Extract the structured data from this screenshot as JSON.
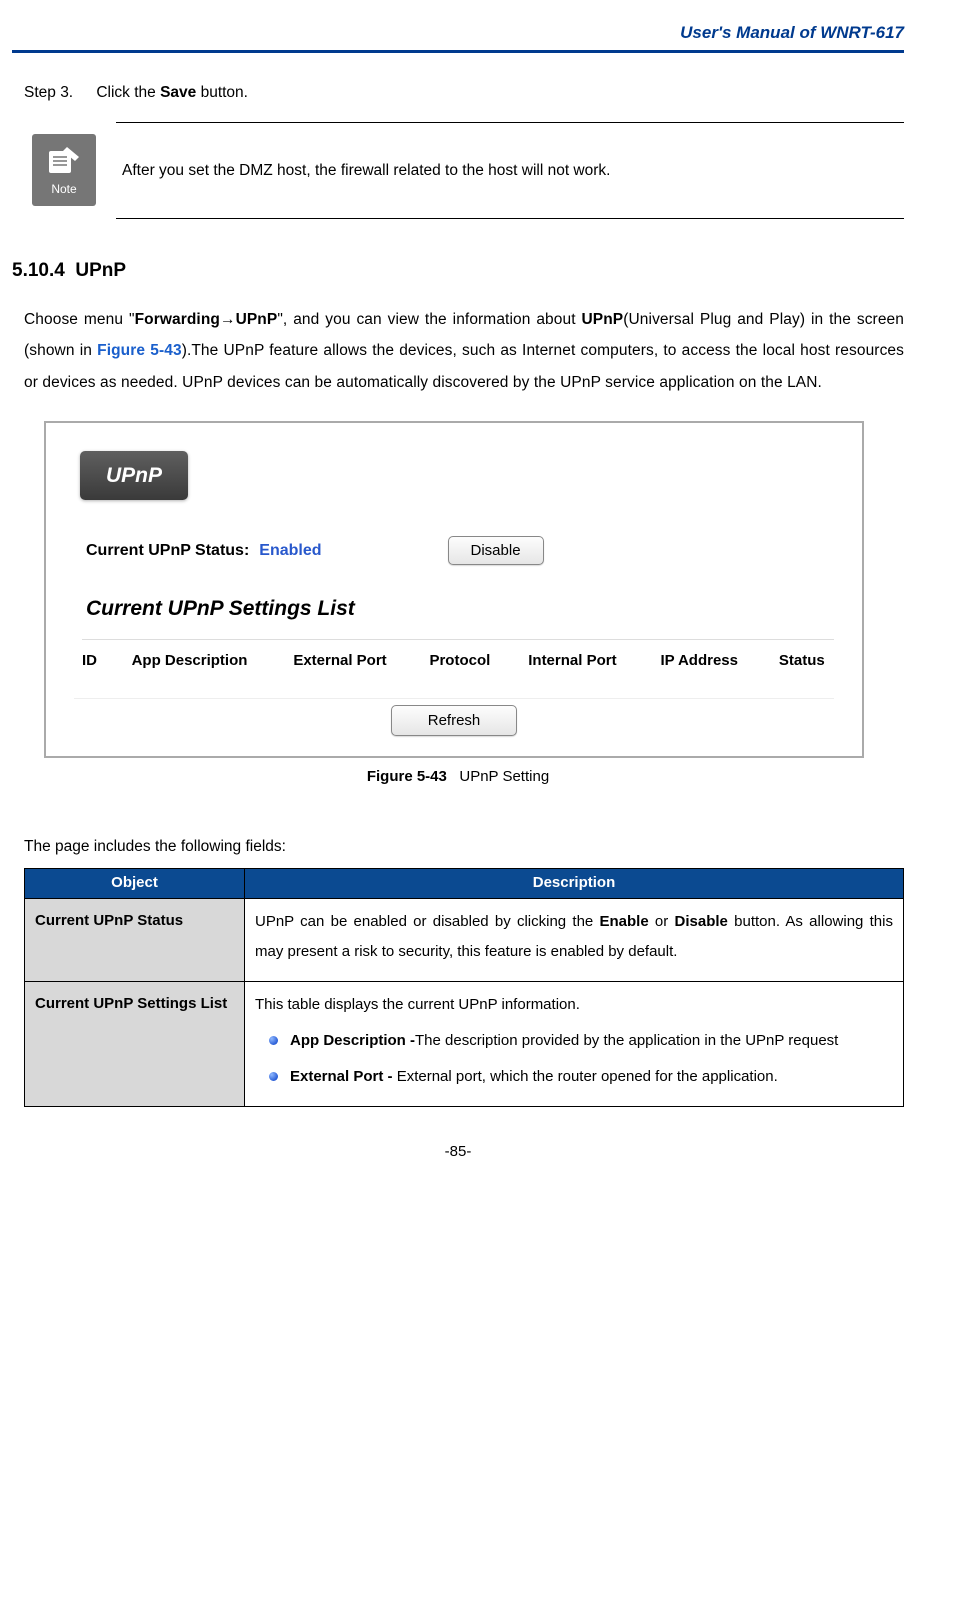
{
  "header": {
    "title": "User's  Manual  of  WNRT-617"
  },
  "step": {
    "label": "Step 3.",
    "prefix": "Click the ",
    "bold": "Save",
    "suffix": " button."
  },
  "note": {
    "icon_label": "Note",
    "text": "After you set the DMZ host, the firewall related to the host will not work."
  },
  "section": {
    "number": "5.10.4",
    "title": "UPnP"
  },
  "paragraph": {
    "p1a": "Choose menu \"",
    "p1b_bold": "Forwarding→UPnP",
    "p1c": "\", and you can view the information about ",
    "p1d_bold": "UPnP",
    "p1e": "(Universal Plug and Play) in the screen (shown in ",
    "figref": "Figure 5-43",
    "p1f": ").The UPnP feature allows the devices, such as Internet computers,  to  access  the  local  host  resources  or  devices  as  needed.  UPnP  devices  can  be automatically discovered by the UPnP service application on the LAN."
  },
  "screenshot": {
    "panel_title": "UPnP",
    "status_label": "Current UPnP Status:",
    "status_value": "Enabled",
    "disable_btn": "Disable",
    "list_title": "Current UPnP Settings List",
    "cols": [
      "ID",
      "App Description",
      "External Port",
      "Protocol",
      "Internal Port",
      "IP Address",
      "Status"
    ],
    "refresh_btn": "Refresh"
  },
  "caption": {
    "bold": "Figure 5-43",
    "rest": "UPnP Setting"
  },
  "fields_intro": "The page includes the following fields:",
  "table": {
    "head_obj": "Object",
    "head_desc": "Description",
    "rows": [
      {
        "obj": "Current UPnP Status",
        "desc_a": "UPnP  can  be  enabled  or  disabled  by  clicking  the  ",
        "desc_b1": "Enable",
        "desc_mid": "  or  ",
        "desc_b2": "Disable",
        "desc_c": " button.  As  allowing  this  may  present  a  risk  to  security,  this  feature  is enabled by default."
      },
      {
        "obj": "Current UPnP Settings List",
        "intro": "This table displays the current UPnP information.",
        "bullets": [
          {
            "b": "App Description -",
            "t": "The description provided by the application in the UPnP request"
          },
          {
            "b": "External  Port  -",
            "t": " External  port,  which  the  router  opened  for  the application."
          }
        ]
      }
    ]
  },
  "page_number": "-85-"
}
